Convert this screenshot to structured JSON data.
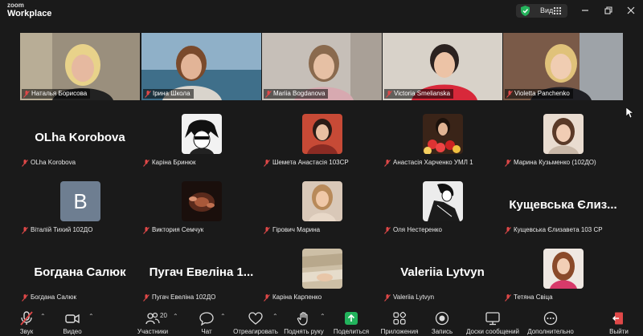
{
  "app": {
    "brand_top": "zoom",
    "brand_bottom": "Workplace",
    "view_label": "Вид"
  },
  "video_tiles": [
    {
      "name": "Наталья Борисова",
      "active": true
    },
    {
      "name": "Ірина Школа",
      "active": false
    },
    {
      "name": "Mariia Bogdanova",
      "active": false
    },
    {
      "name": "Victoria Smelianska",
      "active": false
    },
    {
      "name": "Violetta Panchenko",
      "active": false
    }
  ],
  "grid": [
    {
      "label": "OLha Korobova",
      "display": "OLha Korobova",
      "kind": "text"
    },
    {
      "label": "Каріна Бринюк",
      "kind": "avatar",
      "icon": "manga-avatar"
    },
    {
      "label": "Шемета Анастасія 103СР",
      "kind": "avatar",
      "icon": "photo-avatar"
    },
    {
      "label": "Анастасія Харченко УМЛ 1",
      "kind": "avatar",
      "icon": "flowers-avatar"
    },
    {
      "label": "Марина Кузьменко (102ДО)",
      "kind": "avatar",
      "icon": "photo-avatar"
    },
    {
      "label": "Віталій Тихий 102ДО",
      "kind": "letter",
      "letter": "В"
    },
    {
      "label": "Виктория Семчук",
      "kind": "avatar",
      "icon": "dark-avatar"
    },
    {
      "label": "Гірович Марина",
      "kind": "avatar",
      "icon": "photo-avatar"
    },
    {
      "label": "Оля Нестеренко",
      "kind": "avatar",
      "icon": "manga-avatar"
    },
    {
      "label": "Кущевська Єлизавета 103 СР",
      "display": "Кущевська Єлиз...",
      "kind": "text"
    },
    {
      "label": "Богдана Салюк",
      "display": "Богдана Салюк",
      "kind": "text"
    },
    {
      "label": "Пугач Евеліна 102ДО",
      "display": "Пугач Евеліна 1...",
      "kind": "text"
    },
    {
      "label": "Каріна Карпенко",
      "kind": "avatar",
      "icon": "photo-avatar"
    },
    {
      "label": "Valeriia Lytvyn",
      "display": "Valeriia Lytvyn",
      "kind": "text"
    },
    {
      "label": "Тетяна Свіца",
      "kind": "avatar",
      "icon": "photo-avatar"
    }
  ],
  "toolbar": {
    "audio": "Звук",
    "video": "Видео",
    "participants": "Участники",
    "participants_count": "20",
    "chat": "Чат",
    "react": "Отреагировать",
    "raise_hand": "Поднять руку",
    "share": "Поделиться",
    "apps": "Приложения",
    "record": "Запись",
    "whiteboards": "Доски сообщений",
    "more": "Дополнительно",
    "leave": "Выйти"
  },
  "colors": {
    "active_border": "#4fd17a",
    "share_green": "#22b35c",
    "muted_red": "#e04848",
    "letter_avatar_bg": "#6e7e91"
  }
}
